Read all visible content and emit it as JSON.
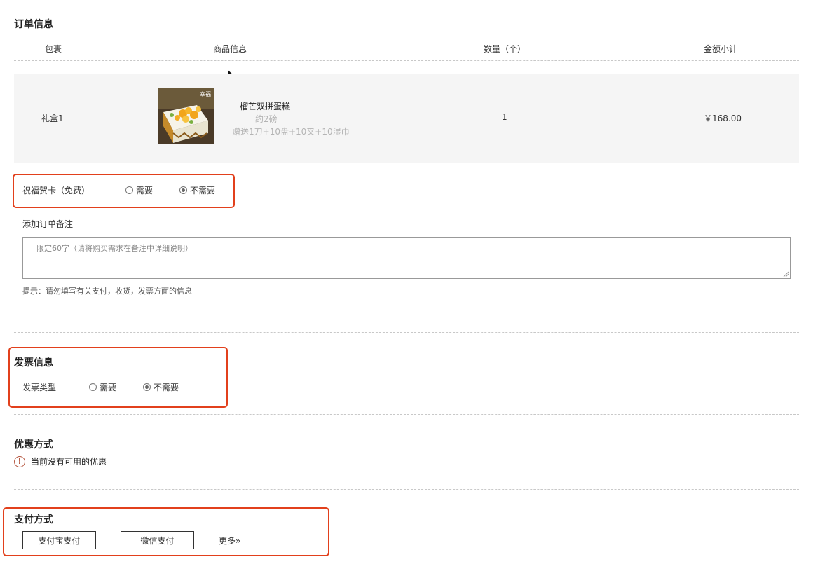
{
  "order": {
    "title": "订单信息",
    "headers": {
      "package": "包裹",
      "product": "商品信息",
      "quantity": "数量（个）",
      "subtotal": "金额小计"
    },
    "item": {
      "package": "礼盒1",
      "image_badge": "幸福",
      "name": "榴芒双拼蛋糕",
      "weight": "约2磅",
      "gift": "赠送1刀+10盘+10叉+10湿巾",
      "quantity": "1",
      "subtotal": "￥168.00"
    }
  },
  "greeting_card": {
    "label": "祝福贺卡（免费）",
    "options": [
      "需要",
      "不需要"
    ],
    "selected": "不需要"
  },
  "remark": {
    "label": "添加订单备注",
    "placeholder": "限定60字（请将购买需求在备注中详细说明）",
    "hint": "提示：请勿填写有关支付，收货，发票方面的信息"
  },
  "invoice": {
    "title": "发票信息",
    "type_label": "发票类型",
    "options": [
      "需要",
      "不需要"
    ],
    "selected": "不需要"
  },
  "discount": {
    "title": "优惠方式",
    "icon": "warning-icon",
    "message": "当前没有可用的优惠"
  },
  "payment": {
    "title": "支付方式",
    "alipay": "支付宝支付",
    "wechat": "微信支付",
    "more": "更多»"
  },
  "colors": {
    "highlight": "#e2401c",
    "row_bg": "#f5f5f5",
    "warning": "#b5553e"
  }
}
